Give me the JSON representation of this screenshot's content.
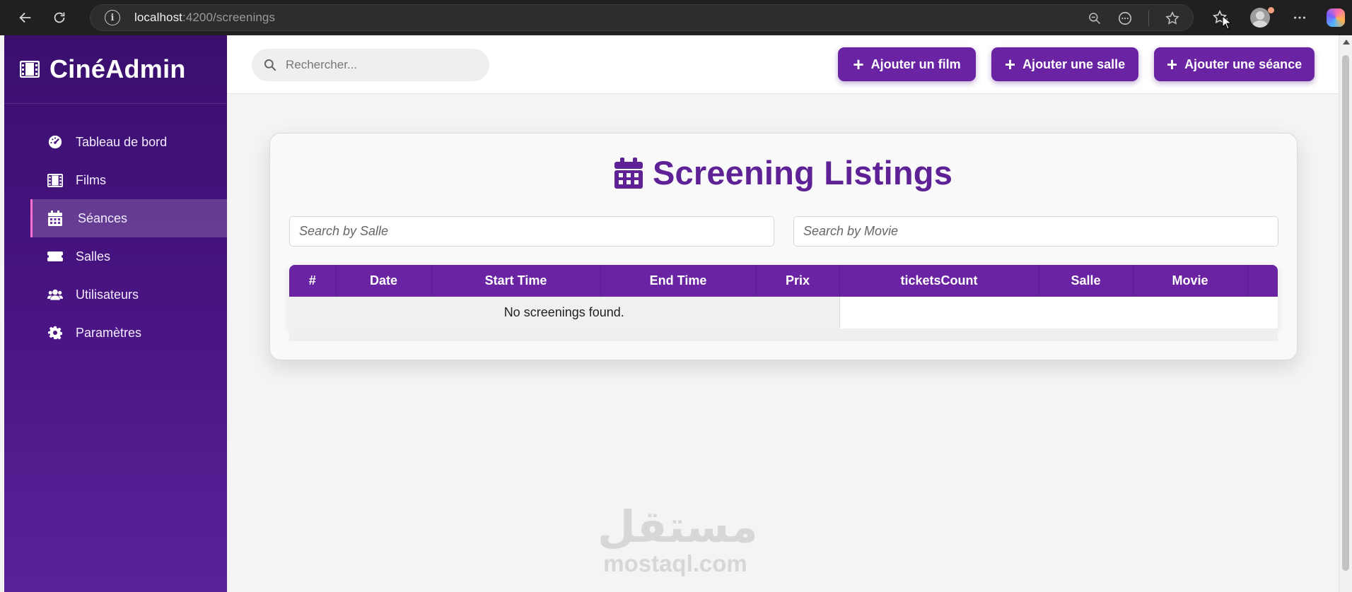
{
  "browser": {
    "url_host": "localhost",
    "url_path": ":4200/screenings"
  },
  "sidebar": {
    "brand": "CinéAdmin",
    "items": [
      {
        "label": "Tableau de bord",
        "icon": "gauge-icon"
      },
      {
        "label": "Films",
        "icon": "film-icon"
      },
      {
        "label": "Séances",
        "icon": "calendar-icon",
        "active": true
      },
      {
        "label": "Salles",
        "icon": "ticket-icon"
      },
      {
        "label": "Utilisateurs",
        "icon": "users-icon"
      },
      {
        "label": "Paramètres",
        "icon": "gear-icon"
      }
    ]
  },
  "topbar": {
    "search_placeholder": "Rechercher...",
    "buttons": {
      "add_film": "Ajouter un film",
      "add_salle": "Ajouter une salle",
      "add_seance": "Ajouter une séance"
    }
  },
  "main": {
    "title": "Screening Listings",
    "filters": {
      "salle_placeholder": "Search by Salle",
      "movie_placeholder": "Search by Movie"
    },
    "table": {
      "columns": [
        "#",
        "Date",
        "Start Time",
        "End Time",
        "Prix",
        "ticketsCount",
        "Salle",
        "Movie",
        ""
      ],
      "empty_message": "No screenings found."
    }
  },
  "watermark": {
    "arabic": "مستقل",
    "latin": "mostaql.com"
  },
  "colors": {
    "accent": "#6a24a3",
    "sidebar_top": "#3a0f6e",
    "sidebar_bottom": "#5b2298",
    "title": "#5e2196"
  }
}
